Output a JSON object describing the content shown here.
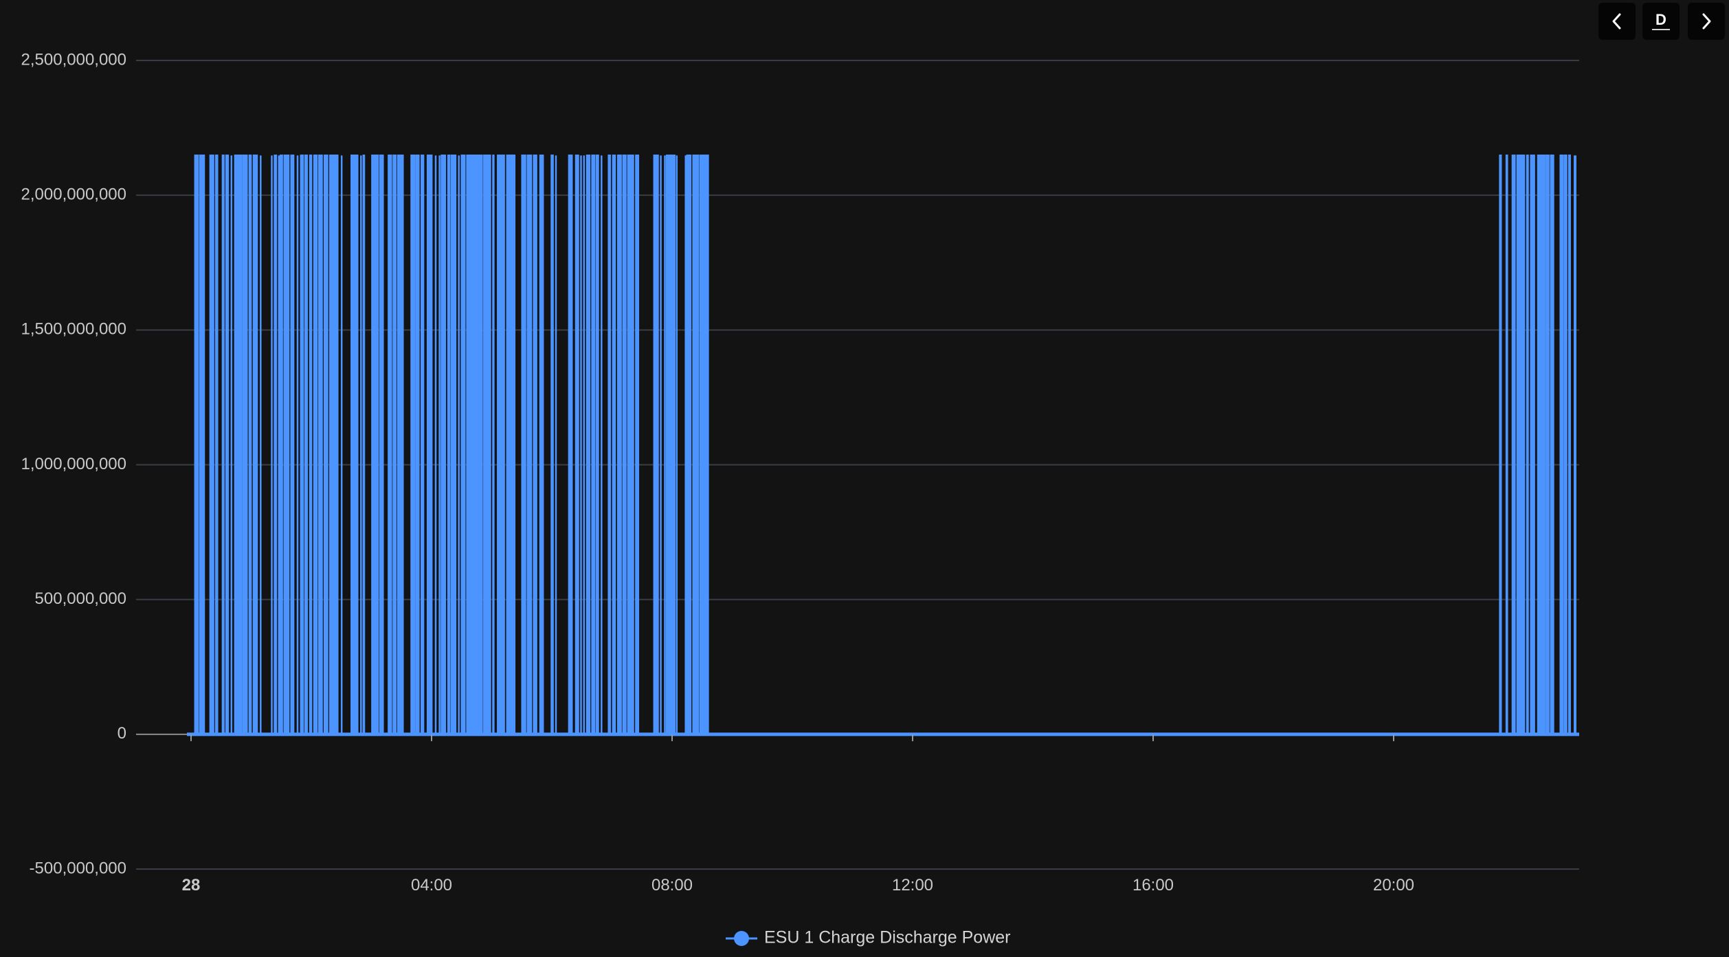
{
  "toolbar": {
    "prev_icon": "chevron-left-icon",
    "period_label": "D",
    "next_icon": "chevron-right-icon"
  },
  "chart_data": {
    "type": "area",
    "title": "",
    "xlabel": "",
    "ylabel": "",
    "ylim": [
      -500000000,
      2500000000
    ],
    "yticks": [
      {
        "value": 2500000000,
        "label": "2,500,000,000"
      },
      {
        "value": 2000000000,
        "label": "2,000,000,000"
      },
      {
        "value": 1500000000,
        "label": "1,500,000,000"
      },
      {
        "value": 1000000000,
        "label": "1,000,000,000"
      },
      {
        "value": 500000000,
        "label": "500,000,000"
      },
      {
        "value": 0,
        "label": "0"
      },
      {
        "value": -500000000,
        "label": "-500,000,000"
      }
    ],
    "xlim": [
      "00:00",
      "24:00"
    ],
    "xticks": [
      {
        "value": "00:00",
        "label": "28",
        "bold": true
      },
      {
        "value": "04:00",
        "label": "04:00"
      },
      {
        "value": "08:00",
        "label": "08:00"
      },
      {
        "value": "12:00",
        "label": "12:00"
      },
      {
        "value": "16:00",
        "label": "16:00"
      },
      {
        "value": "20:00",
        "label": "20:00"
      }
    ],
    "grid": true,
    "legend_position": "bottom-center",
    "colors": {
      "series": "#4c94ff",
      "grid": "#3a3d45",
      "axis": "#c9c9c9",
      "background": "#131313"
    },
    "series": [
      {
        "name": "ESU 1 Charge Discharge Power",
        "peak_value": 2147483647,
        "base_value": 0,
        "active_periods": [
          [
            "00:04",
            "01:13"
          ],
          [
            "01:20",
            "02:32"
          ],
          [
            "02:40",
            "03:52"
          ],
          [
            "03:56",
            "05:02"
          ],
          [
            "05:06",
            "06:20"
          ],
          [
            "06:24",
            "07:34"
          ],
          [
            "07:42",
            "08:38"
          ],
          [
            "21:46",
            "22:56"
          ]
        ],
        "step_minutes": 2
      }
    ]
  }
}
